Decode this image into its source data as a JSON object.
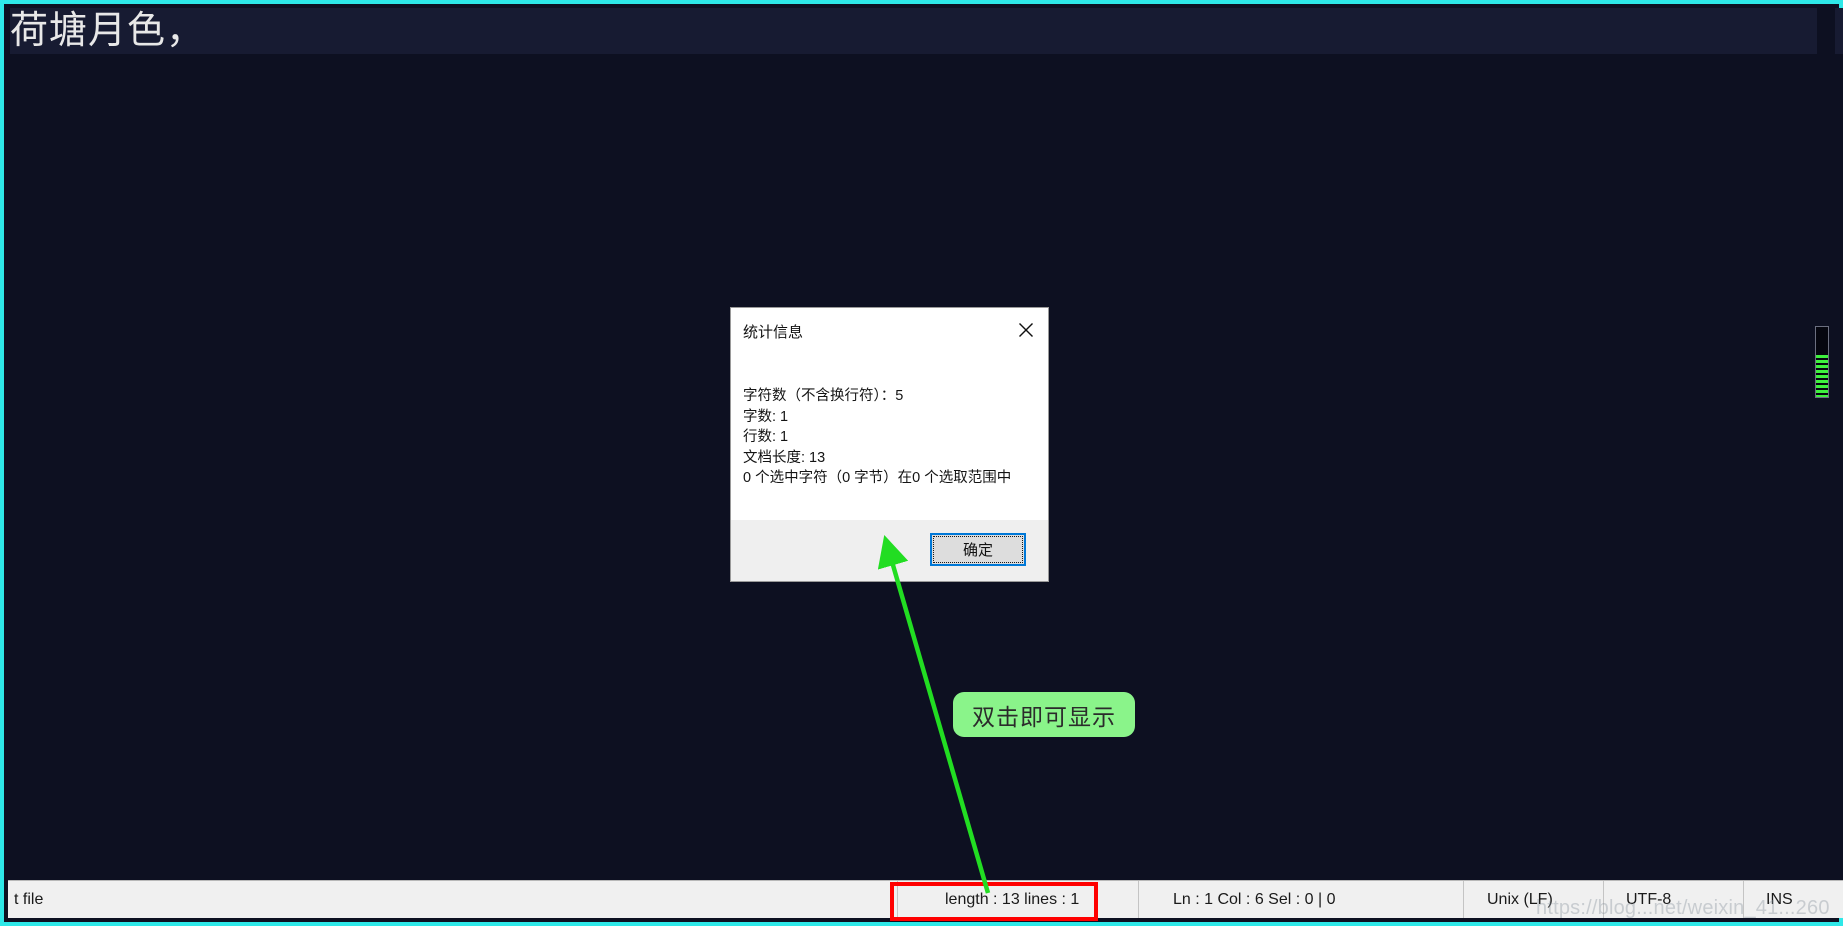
{
  "editor": {
    "document_text": "荷塘月色，",
    "background_color": "#0d1021",
    "current_line_color": "#171b32",
    "frame_border_color": "#2ee8e8"
  },
  "minimap": {
    "name": "document-map-thumb"
  },
  "dialog": {
    "title": "统计信息",
    "close_icon": "close-icon",
    "lines": [
      "字符数（不含换行符）：5",
      "字数: 1",
      "行数: 1",
      "文档长度: 13",
      "0 个选中字符（0 字节）在0 个选取范围中"
    ],
    "ok_label": "确定",
    "focus_color": "#0078d7"
  },
  "annotation": {
    "callout_text": "双击即可显示",
    "callout_color": "#8af48a",
    "arrow_color": "#22dd22",
    "highlight_color": "#ff0000"
  },
  "status_bar": {
    "file_type": "t file",
    "length_lines": "length : 13   lines : 1",
    "caret": "Ln : 1   Col : 6   Sel : 0 | 0",
    "eol": "Unix (LF)",
    "encoding": "UTF-8",
    "insert_mode": "INS"
  },
  "watermark": {
    "text": "https://blog...net/weixin_41...260"
  }
}
